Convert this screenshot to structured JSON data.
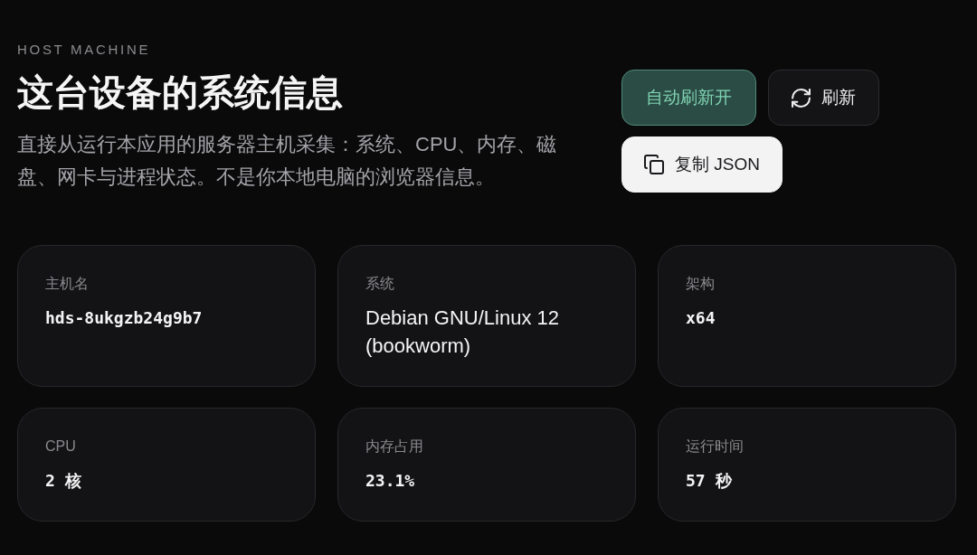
{
  "header": {
    "eyebrow": "HOST MACHINE",
    "title": "这台设备的系统信息",
    "description": "直接从运行本应用的服务器主机采集：系统、CPU、内存、磁盘、网卡与进程状态。不是你本地电脑的浏览器信息。"
  },
  "actions": [
    {
      "kind": "toggle",
      "label": "自动刷新开",
      "on": true
    },
    {
      "kind": "secondary",
      "label": "刷新"
    },
    {
      "kind": "primary",
      "label": "复制 JSON"
    }
  ],
  "cards": [
    {
      "label": "主机名",
      "value": "hds-8ukgzb24g9b7",
      "kind": "mono"
    },
    {
      "label": "系统",
      "value": "Debian GNU/Linux 12 (bookworm)",
      "kind": "text"
    },
    {
      "label": "架构",
      "value": "x64",
      "kind": "mono"
    },
    {
      "label": "CPU",
      "value": "2 核",
      "kind": "mono"
    },
    {
      "label": "内存占用",
      "value": "23.1%",
      "kind": "mono"
    },
    {
      "label": "运行时间",
      "value": "57 秒",
      "kind": "mono"
    }
  ]
}
